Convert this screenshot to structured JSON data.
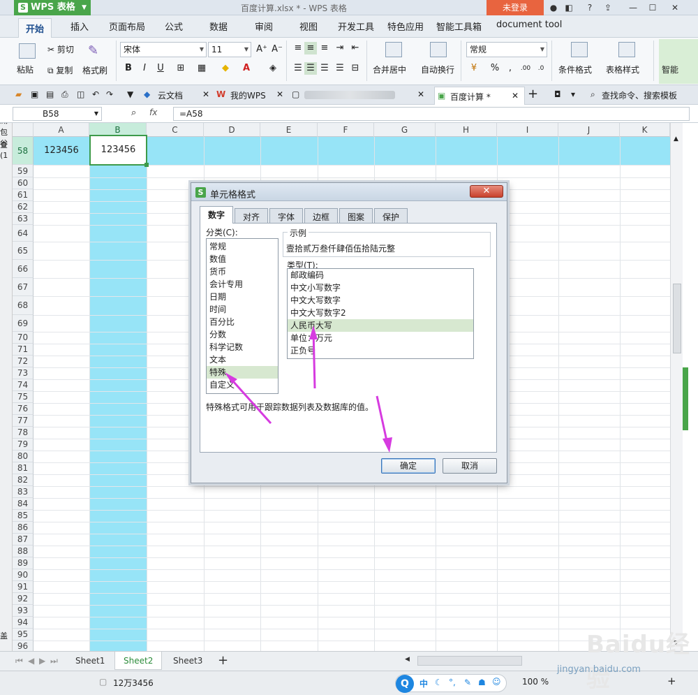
{
  "titlebar": {
    "app_name": "WPS 表格",
    "doc_title": "百度计算.xlsx * - WPS 表格",
    "login_label": "未登录"
  },
  "ribbon_tabs": [
    "开始",
    "插入",
    "页面布局",
    "公式",
    "数据",
    "审阅",
    "视图",
    "开发工具",
    "特色应用",
    "智能工具箱",
    "document tool"
  ],
  "ribbon": {
    "paste": "粘贴",
    "cut": "剪切",
    "copy": "复制",
    "format_painter": "格式刷",
    "font_name": "宋体",
    "font_size": "11",
    "merge_center": "合并居中",
    "wrap_text": "自动换行",
    "number_format": "常规",
    "conditional_format": "条件格式",
    "table_style": "表格样式",
    "smart": "智能"
  },
  "doc_tabs": {
    "cloud": "云文档",
    "mywps": "我的WPS",
    "active": "百度计算 *",
    "search": "查找命令、搜索模板"
  },
  "formula_bar": {
    "name_box": "B58",
    "fx": "fx",
    "formula": "=A58"
  },
  "grid": {
    "columns": [
      "A",
      "B",
      "C",
      "D",
      "E",
      "F",
      "G",
      "H",
      "I",
      "J",
      "K"
    ],
    "rows": [
      "58",
      "59",
      "60",
      "61",
      "62",
      "63",
      "64",
      "65",
      "66",
      "67",
      "68",
      "69",
      "70",
      "71",
      "72",
      "73",
      "74",
      "75",
      "76",
      "77",
      "78",
      "79",
      "80",
      "81",
      "82",
      "83",
      "84",
      "85",
      "86",
      "87",
      "88",
      "89",
      "90",
      "91",
      "92",
      "93",
      "94",
      "95",
      "96"
    ],
    "a58": "123456",
    "b58": "123456",
    "left_fragments": [
      "湖",
      "包谷",
      "查",
      "(1",
      "盖"
    ]
  },
  "sheets": [
    "Sheet1",
    "Sheet2",
    "Sheet3"
  ],
  "status": {
    "value": "12万3456",
    "zoom": "100 %",
    "ime": "中"
  },
  "dialog": {
    "title": "单元格格式",
    "tabs": [
      "数字",
      "对齐",
      "字体",
      "边框",
      "图案",
      "保护"
    ],
    "category_label": "分类(C):",
    "categories": [
      "常规",
      "数值",
      "货币",
      "会计专用",
      "日期",
      "时间",
      "百分比",
      "分数",
      "科学记数",
      "文本",
      "特殊",
      "自定义"
    ],
    "selected_category": "特殊",
    "sample_legend": "示例",
    "sample_value": "壹拾贰万叁仟肆佰伍拾陆元整",
    "type_label": "类型(T):",
    "types": [
      "邮政编码",
      "中文小写数字",
      "中文大写数字",
      "中文大写数字2",
      "人民币大写",
      "单位：万元",
      "正负号"
    ],
    "selected_type": "人民币大写",
    "description": "特殊格式可用于跟踪数据列表及数据库的值。",
    "ok": "确定",
    "cancel": "取消"
  },
  "watermark": {
    "brand": "Baidu经验",
    "url": "jingyan.baidu.com"
  },
  "colors": {
    "accent_green": "#49a54a",
    "selection_cyan": "#97e4f7",
    "login_orange": "#e8643f",
    "arrow_magenta": "#d63be0"
  }
}
